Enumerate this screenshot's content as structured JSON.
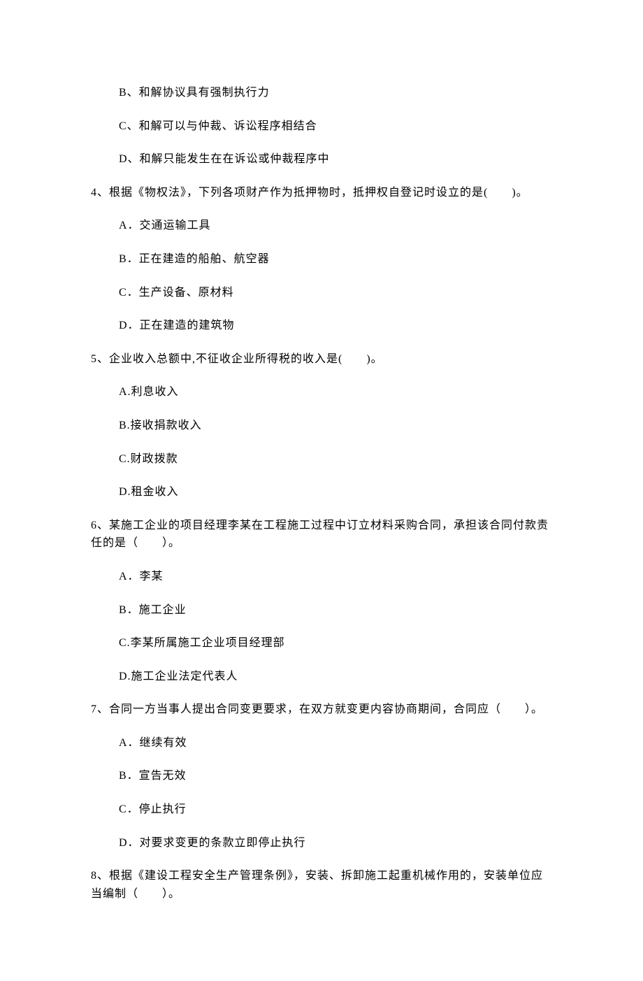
{
  "options_before": [
    "B、和解协议具有强制执行力",
    "C、和解可以与仲裁、诉讼程序相结合",
    "D、和解只能发生在在诉讼或仲裁程序中"
  ],
  "questions": [
    {
      "stem": "4、根据《物权法》，下列各项财产作为抵押物时，抵押权自登记时设立的是(　　)。",
      "options": [
        "A．交通运输工具",
        "B．正在建造的船舶、航空器",
        "C．生产设备、原材料",
        "D．正在建造的建筑物"
      ]
    },
    {
      "stem": "5、企业收入总额中,不征收企业所得税的收入是(　　)。",
      "options": [
        "A.利息收入",
        "B.接收捐款收入",
        "C.财政拨款",
        "D.租金收入"
      ]
    },
    {
      "stem": "6、某施工企业的项目经理李某在工程施工过程中订立材料采购合同，承担该合同付款责任的是（　　）。",
      "options": [
        "A．李某",
        "B．施工企业",
        "C.李某所属施工企业项目经理部",
        "D.施工企业法定代表人"
      ]
    },
    {
      "stem": "7、合同一方当事人提出合同变更要求，在双方就变更内容协商期间，合同应（　　）。",
      "options": [
        "A．继续有效",
        "B．宣告无效",
        "C．停止执行",
        "D．对要求变更的条款立即停止执行"
      ]
    },
    {
      "stem": "8、根据《建设工程安全生产管理条例》，安装、拆卸施工起重机械作用的，安装单位应当编制（　　）。",
      "options": []
    }
  ]
}
